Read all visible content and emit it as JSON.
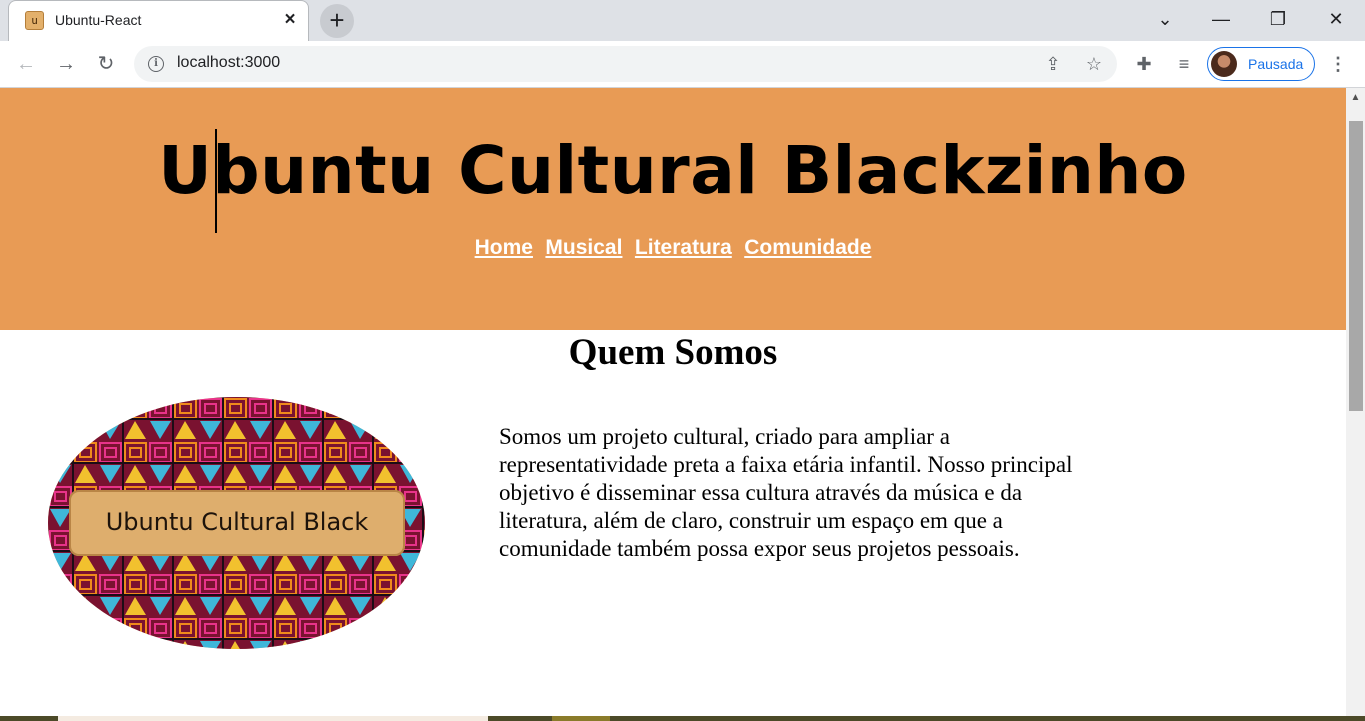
{
  "browser": {
    "tab_title": "Ubuntu-React",
    "tab_favicon_letter": "u",
    "url": "localhost:3000",
    "profile_label": "Pausada",
    "accent_color": "#1a73e8"
  },
  "page": {
    "site_title": "Ubuntu Cultural Blackzinho",
    "nav": [
      "Home",
      "Musical",
      "Literatura",
      "Comunidade"
    ],
    "section_title": "Quem Somos",
    "logo_text": "Ubuntu Cultural Black",
    "about_text": "Somos um projeto cultural, criado para ampliar a representatividade preta a faixa etária infantil. Nosso principal objetivo é disseminar essa cultura através da música e da literatura, além de claro, construir um espaço em que a comunidade também possa expor seus projetos pessoais.",
    "hero_color": "#e89b55",
    "nav_color": "#ffffff"
  },
  "icons": {
    "close": "close-icon",
    "new_tab": "plus-icon",
    "back": "arrow-left-icon",
    "forward": "arrow-right-icon",
    "reload": "reload-icon",
    "info": "info-icon",
    "share": "share-icon",
    "bookmark": "star-icon",
    "extensions": "puzzle-icon",
    "media": "media-queue-icon",
    "menu": "kebab-menu-icon"
  }
}
